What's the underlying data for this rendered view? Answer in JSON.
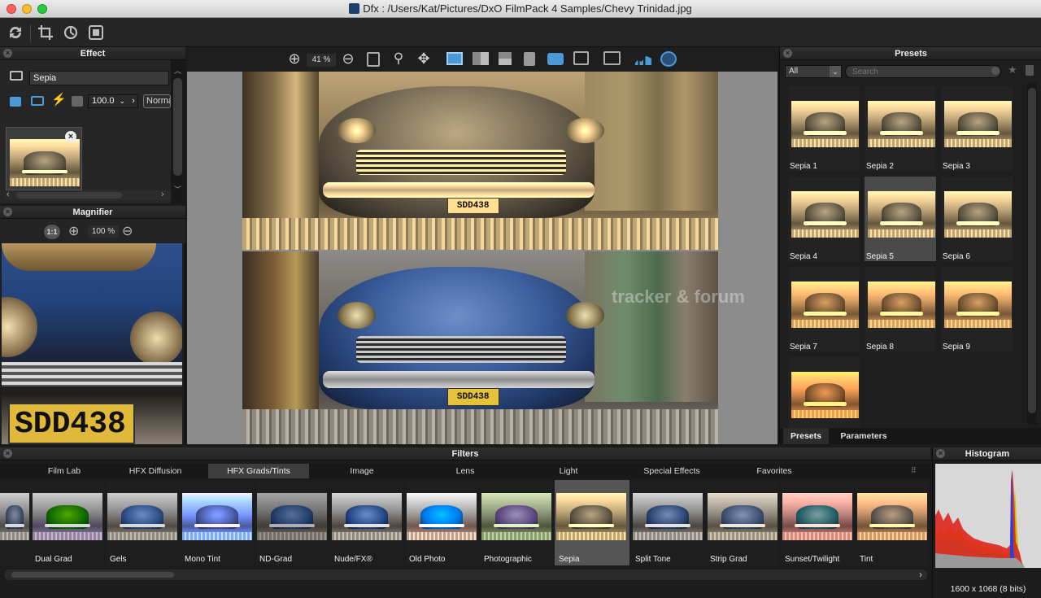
{
  "window": {
    "title": "Dfx : /Users/Kat/Pictures/DxO FilmPack 4 Samples/Chevy Trinidad.jpg"
  },
  "toolbar": {
    "icons": [
      "refresh-icon",
      "crop-icon",
      "rotate-icon",
      "fit-screen-icon"
    ]
  },
  "effect_panel": {
    "title": "Effect",
    "effect_name": "Sepia",
    "opacity_value": "100.0",
    "blend_mode": "Normal"
  },
  "magnifier_panel": {
    "title": "Magnifier",
    "ratio_label": "1:1",
    "zoom_value": "100 %"
  },
  "viewer_toolbar": {
    "zoom_value": "41 %"
  },
  "viewer": {
    "watermark": "tracker & forum",
    "plate_text": "SDD438"
  },
  "presets_panel": {
    "title": "Presets",
    "filter_select": "All",
    "search_placeholder": "Search",
    "items": [
      "Sepia 1",
      "Sepia 2",
      "Sepia 3",
      "Sepia 4",
      "Sepia 5",
      "Sepia 6",
      "Sepia 7",
      "Sepia 8",
      "Sepia 9",
      ""
    ],
    "selected_index": 4,
    "tabs": [
      "Presets",
      "Parameters"
    ]
  },
  "filters_panel": {
    "title": "Filters",
    "tabs": [
      "Film Lab",
      "HFX Diffusion",
      "HFX Grads/Tints",
      "Image",
      "Lens",
      "Light",
      "Special Effects",
      "Favorites"
    ],
    "active_tab": "HFX Grads/Tints",
    "items": [
      "",
      "Dual Grad",
      "Gels",
      "Mono Tint",
      "ND-Grad",
      "Nude/FX®",
      "Old Photo",
      "Photographic",
      "Sepia",
      "Split Tone",
      "Strip Grad",
      "Sunset/Twilight",
      "Tint"
    ],
    "selected": "Sepia"
  },
  "histogram_panel": {
    "title": "Histogram",
    "info": "1600 x 1068 (8 bits)"
  },
  "colors": {
    "accent_blue": "#4a9ad8",
    "panel_bg": "#1b1b1b",
    "selected_bg": "#4a4a4a"
  }
}
